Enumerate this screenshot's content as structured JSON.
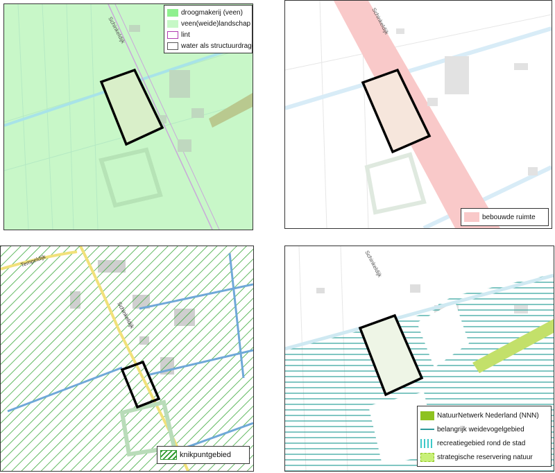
{
  "panels": [
    {
      "id": "top-left",
      "road_label": "Schinkeldijk",
      "legend": [
        {
          "label": "droogmakerij (veen)",
          "color": "#8ff08f"
        },
        {
          "label": "veen(weide)landschap",
          "color": "#c6f8c6"
        },
        {
          "label": "lint",
          "color": "#b03cb0"
        },
        {
          "label": "water als structuurdrager",
          "color": "#555555"
        }
      ]
    },
    {
      "id": "top-right",
      "road_label": "Schinkeldijk",
      "legend": [
        {
          "label": "bebouwde ruimte",
          "color": "#f7b3b3"
        }
      ]
    },
    {
      "id": "bottom-left",
      "road_labels": [
        "Tempeldijk",
        "Schinkeldijk"
      ],
      "legend": [
        {
          "label": "knikpuntgebied",
          "color": "#2e9a2e"
        }
      ]
    },
    {
      "id": "bottom-right",
      "road_label": "Schinkeldijk",
      "legend": [
        {
          "label": "NatuurNetwerk Nederland (NNN)",
          "color": "#8dc21f"
        },
        {
          "label": "belangrijk weidevogelgebied",
          "color": "#2a9a9a"
        },
        {
          "label": "recreatiegebied rond de stad",
          "color": "#3cc8c8"
        },
        {
          "label": "strategische reservering natuur",
          "color": "#c8f078"
        }
      ]
    }
  ]
}
